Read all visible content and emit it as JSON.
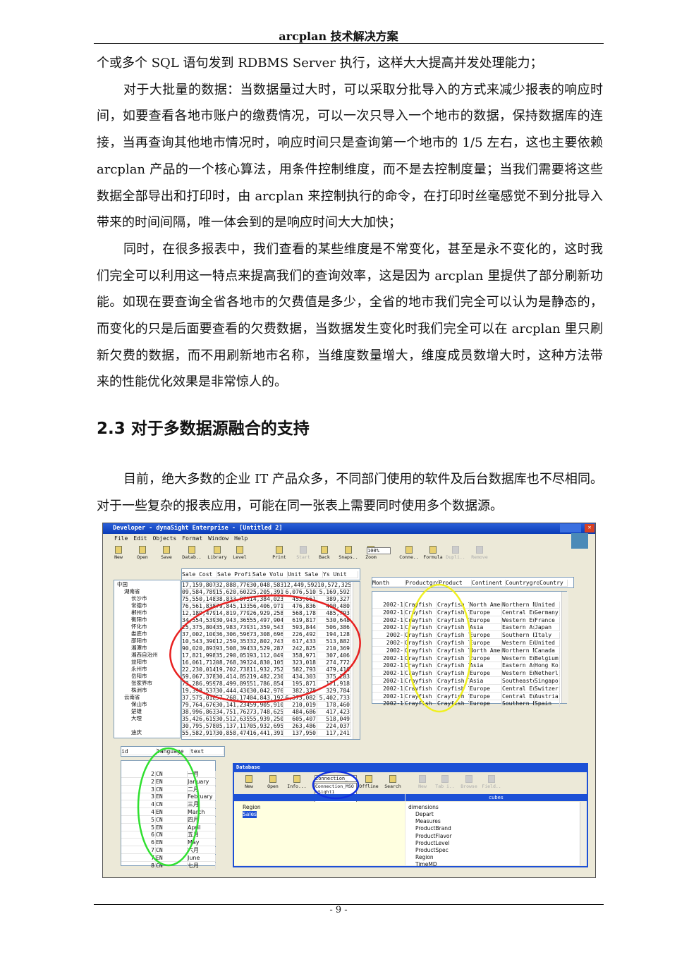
{
  "header": {
    "title": "arcplan 技术解决方案"
  },
  "paragraphs": [
    "个或多个 SQL 语句发到 RDBMS Server 执行，这样大大提高并发处理能力；",
    "对于大批量的数据：当数据量过大时，可以采取分批导入的方式来减少报表的响应时间，如要查看各地市账户的缴费情况，可以一次只导入一个地市的数据，保持数据库的连接，当再查询其他地市情况时，响应时间只是查询第一个地市的 1/5 左右，这也主要依赖 arcplan 产品的一个核心算法，用条件控制维度，而不是去控制度量；当我们需要将这些数据全部导出和打印时，由 arcplan 来控制执行的命令，在打印时丝毫感觉不到分批导入带来的时间间隔，唯一体会到的是响应时间大大加快；",
    "同时，在很多报表中，我们查看的某些维度是不常变化，甚至是永不变化的，这时我们完全可以利用这一特点来提高我们的查询效率，这是因为 arcplan 里提供了部分刷新功能。如现在要查询全省各地市的欠费值是多少，全省的地市我们完全可以认为是静态的，而变化的只是后面要查看的欠费数据，当数据发生变化时我们完全可以在 arcplan 里只刷新欠费的数据，而不用刷新地市名称，当维度数量增大，维度成员数增大时，这种方法带来的性能优化效果是非常惊人的。"
  ],
  "section": {
    "title": "2.3 对于多数据源融合的支持",
    "paragraphs": [
      "目前，绝大多数的企业 IT 产品众多，不同部门使用的软件及后台数据库也不尽相同。对于一些复杂的报表应用，可能在同一张表上需要同时使用多个数据源。"
    ]
  },
  "screenshot": {
    "window_title": "Developer - dynaSight Enterprise - [Untitled 2]",
    "menu": [
      "File",
      "Edit",
      "Objects",
      "Format",
      "Window",
      "Help"
    ],
    "toolbar": [
      {
        "label": "New"
      },
      {
        "label": "Open"
      },
      {
        "label": "Save"
      },
      {
        "label": "Datab.."
      },
      {
        "label": "Library"
      },
      {
        "label": "Level"
      },
      {
        "label": "Print"
      },
      {
        "label": "Start",
        "disabled": true
      },
      {
        "label": "Back"
      },
      {
        "label": "Snaps.."
      },
      {
        "label": "Zoom"
      },
      {
        "label": "Conne.."
      },
      {
        "label": "Formula"
      },
      {
        "label": "Dupli..",
        "disabled": true
      },
      {
        "label": "Remove",
        "disabled": true
      }
    ],
    "zoom_value": "100%",
    "tree": [
      "中国",
      "湖南省",
      "长沙市",
      "常德市",
      "郴州市",
      "衡阳市",
      "怀化市",
      "娄底市",
      "邵阳市",
      "湘潭市",
      "湘西自治州",
      "益阳市",
      "永州市",
      "岳阳市",
      "张家界市",
      "株洲市",
      "云南省",
      "保山市",
      "楚雄",
      "大理",
      "",
      "迪庆"
    ],
    "sales_table": {
      "columns": [
        "Sale Cost",
        "Sale Profi",
        "Sale Volu",
        "Unit Sale",
        "Ys Unit"
      ],
      "rows": [
        [
          "17,159,807",
          "32,888,776",
          "30,048,583",
          "12,449,592",
          "10,572,325"
        ],
        [
          "09,584,789",
          "15,620,602",
          "25,205,391",
          "6,076,510",
          "5,169,592"
        ],
        [
          "75,550,148",
          "38,833,875",
          "14,384,023",
          "453,661",
          "389,327"
        ],
        [
          "76,561,838",
          "79,845,133",
          "56,406,971",
          "476,836",
          "400,480"
        ],
        [
          "12,189,479",
          "14,819,779",
          "26,929,258",
          "568,178",
          "485,793"
        ],
        [
          "34,554,539",
          "30,943,365",
          "55,497,904",
          "619,817",
          "530,648"
        ],
        [
          "25,375,804",
          "35,983,739",
          "31,359,543",
          "593,844",
          "506,386"
        ],
        [
          "37,002,100",
          "36,306,596",
          "73,308,696",
          "226,492",
          "194,128"
        ],
        [
          "10,543,390",
          "12,259,353",
          "32,802,743",
          "617,433",
          "513,882"
        ],
        [
          "90,020,893",
          "93,508,394",
          "33,529,287",
          "242,825",
          "210,369"
        ],
        [
          "17,821,998",
          "35,290,051",
          "93,112,049",
          "358,971",
          "307,406"
        ],
        [
          "16,061,712",
          "08,768,393",
          "24,830,105",
          "323,018",
          "274,772"
        ],
        [
          "22,230,014",
          "19,702,738",
          "11,932,752",
          "582,793",
          "479,416"
        ],
        [
          "59,067,378",
          "30,414,852",
          "19,482,230",
          "434,303",
          "375,283"
        ],
        [
          "73,286,959",
          "78,499,895",
          "51,786,854",
          "195,871",
          "171,918"
        ],
        [
          "19,398,537",
          "30,444,430",
          "30,042,976",
          "382,378",
          "329,784"
        ],
        [
          "37,575,018",
          "57,268,174",
          "04,843,192",
          "6,373,082",
          "5,402,733"
        ],
        [
          "79,764,676",
          "30,141,234",
          "59,905,910",
          "210,019",
          "178,460"
        ],
        [
          "38,996,863",
          "34,751,762",
          "73,748,625",
          "484,686",
          "417,423"
        ],
        [
          "35,426,615",
          "30,512,635",
          "55,939,250",
          "605,407",
          "518,049"
        ],
        [
          "30,795,578",
          "05,137,117",
          "05,932,695",
          "263,486",
          "224,037"
        ],
        [
          "55,582,917",
          "30,858,474",
          "16,441,391",
          "137,950",
          "117,241"
        ]
      ]
    },
    "product_table": {
      "columns": [
        "Month",
        "Productgro",
        "Product",
        "Continent",
        "Countrygro",
        "Country"
      ],
      "rows": [
        [
          "2002-1",
          "Crayfish",
          "Crayfish l",
          "North Amer",
          "Northern N",
          "United"
        ],
        [
          "2002-1",
          "Crayfish",
          "Crayfish l",
          "Europe",
          "Central Eu",
          "Germany"
        ],
        [
          "2002-1",
          "Crayfish",
          "Crayfish l",
          "Europe",
          "Western Eu",
          "France"
        ],
        [
          "2002-1",
          "Crayfish",
          "Crayfish l",
          "Asia",
          "Eastern As",
          "Japan"
        ],
        [
          "2002-",
          "Crayfish",
          "Crayfish l",
          "Europe",
          "Southern E",
          "Italy"
        ],
        [
          "2002-",
          "Crayfish",
          "Crayfish l",
          "Europe",
          "Western Eu",
          "United"
        ],
        [
          "2002-",
          "Crayfish",
          "Crayfish l",
          "North Amer",
          "Northern N",
          "Canada"
        ],
        [
          "2002-1",
          "Crayfish",
          "Crayfish l",
          "Europe",
          "Western Eu",
          "Belgium"
        ],
        [
          "2002-1",
          "Crayfish",
          "Crayfish l",
          "Asia",
          "Eastern As",
          "Hong Ko"
        ],
        [
          "2002-1",
          "Crayfish",
          "Crayfish l",
          "Europe",
          "Western Eu",
          "Netherl"
        ],
        [
          "2002-1",
          "Crayfish",
          "Crayfish l",
          "Asia",
          "Southeaste",
          "Singapo"
        ],
        [
          "2002-1",
          "Crayfish",
          "Crayfish l",
          "Europe",
          "Central Eu",
          "Switzer"
        ],
        [
          "2002-1",
          "Crayfish",
          "Crayfish l",
          "Europe",
          "Central Eu",
          "Austria"
        ],
        [
          "2002-1",
          "Crayfish",
          "Crayfish l",
          "Europe",
          "Southern E",
          "Spain"
        ]
      ]
    },
    "month_table": {
      "columns": [
        "id",
        "language",
        "text"
      ],
      "rows": [
        [
          "2",
          "CN",
          "一月"
        ],
        [
          "2",
          "EN",
          "January"
        ],
        [
          "3",
          "CN",
          "二月"
        ],
        [
          "3",
          "EN",
          "February"
        ],
        [
          "4",
          "CN",
          "三月"
        ],
        [
          "4",
          "EN",
          "March"
        ],
        [
          "5",
          "CN",
          "四月"
        ],
        [
          "5",
          "EN",
          "April"
        ],
        [
          "6",
          "CN",
          "五月"
        ],
        [
          "6",
          "EN",
          "May"
        ],
        [
          "7",
          "CN",
          "六月"
        ],
        [
          "7",
          "EN",
          "June"
        ],
        [
          "8",
          "CN",
          "七月"
        ]
      ]
    },
    "database": {
      "title": "Database",
      "toolbar": [
        {
          "label": "New"
        },
        {
          "label": "Open"
        },
        {
          "label": "Info..."
        },
        {
          "label": "Offline"
        },
        {
          "label": "Search"
        },
        {
          "label": "New",
          "disabled": true
        },
        {
          "label": "Tab i..",
          "disabled": true
        },
        {
          "label": "Browse",
          "disabled": true
        },
        {
          "label": "Field..",
          "disabled": true
        }
      ],
      "connection_value": "Connection_",
      "connection_options": [
        "Connection_MSO",
        "nSight1",
        "Connection_"
      ],
      "left_folders": [
        "Region",
        "Sales"
      ],
      "cubes_label": "cubes",
      "dimensions_root": "dimensions",
      "dimensions": [
        "Depart",
        "Measures",
        "ProductBrand",
        "ProductFlavor",
        "ProductLevel",
        "ProductSpec",
        "Region",
        "TimeMD"
      ]
    },
    "annotation_colors": {
      "red": "#e82020",
      "yellow": "#f0f020",
      "green": "#30e030",
      "blue": "#1030e0"
    }
  },
  "footer": {
    "page": "- 9 -"
  }
}
